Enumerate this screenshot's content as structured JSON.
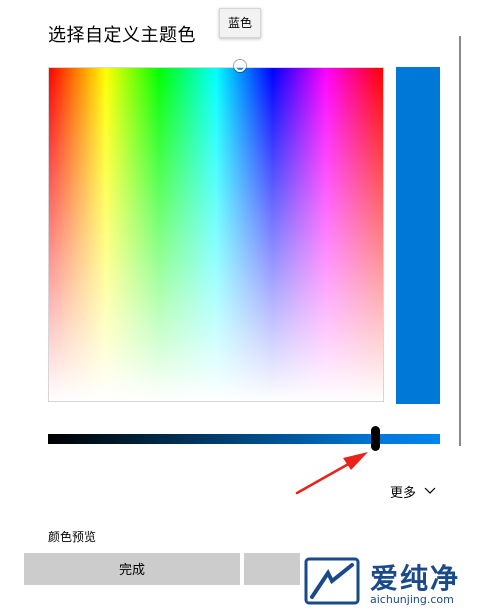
{
  "dialog": {
    "title": "选择自定义主题色",
    "tooltip": "蓝色",
    "more_label": "更多",
    "preview_section_label": "颜色预览",
    "done_button": "完成",
    "selected_color": "#0078d7"
  },
  "watermark": {
    "text": "爱纯净",
    "url": "aichunjing.com"
  },
  "icons": {
    "more": "chevron-down-icon",
    "annotation": "red-arrow-annotation"
  }
}
